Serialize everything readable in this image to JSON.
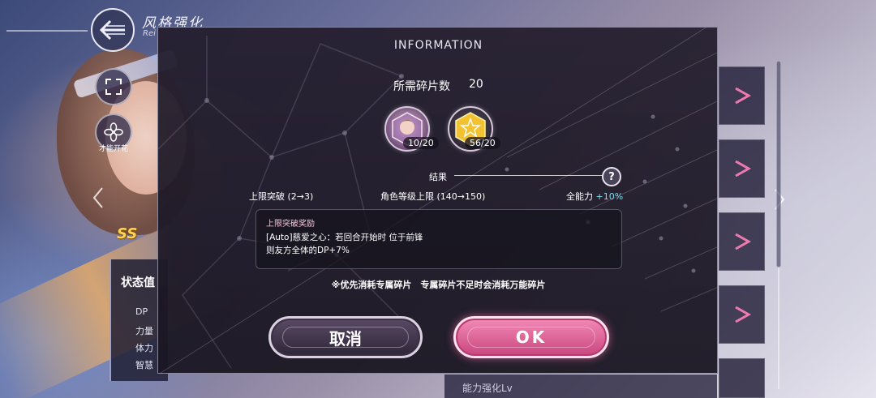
{
  "header": {
    "title": "风格强化",
    "subtitle": "Rei"
  },
  "left_menu": {
    "talent_label": "才能开花"
  },
  "rarity_badge": "SS",
  "status_panel": {
    "title": "状态值",
    "rows": [
      "DP",
      "力量",
      "体力",
      "智慧"
    ]
  },
  "bottom_strip": {
    "text": "能力强化Lv"
  },
  "modal": {
    "title": "INFORMATION",
    "required_label": "所需碎片数",
    "required_value": "20",
    "shards": [
      {
        "name": "dedicated-shard",
        "count": "10/20"
      },
      {
        "name": "universal-shard",
        "count": "56/20"
      }
    ],
    "result_label": "结果",
    "help_label": "?",
    "stats": [
      {
        "label": "上限突破",
        "value": "(2→3)"
      },
      {
        "label": "角色等级上限",
        "value": "(140→150)"
      },
      {
        "label": "全能力",
        "value": "+10%"
      }
    ],
    "bonus": {
      "title": "上限突破奖励",
      "lines": [
        "[Auto]慈爱之心：若回合开始时 位于前锋",
        "则友方全体的DP+7%"
      ]
    },
    "note": "※优先消耗专属碎片　专属碎片不足时会消耗万能碎片",
    "cancel_label": "取消",
    "ok_label": "OK"
  },
  "colors": {
    "accent_pink": "#e8609a",
    "highlight_cyan": "#7fdcef",
    "panel_dark": "#241e2e",
    "gold": "#f2c230"
  }
}
